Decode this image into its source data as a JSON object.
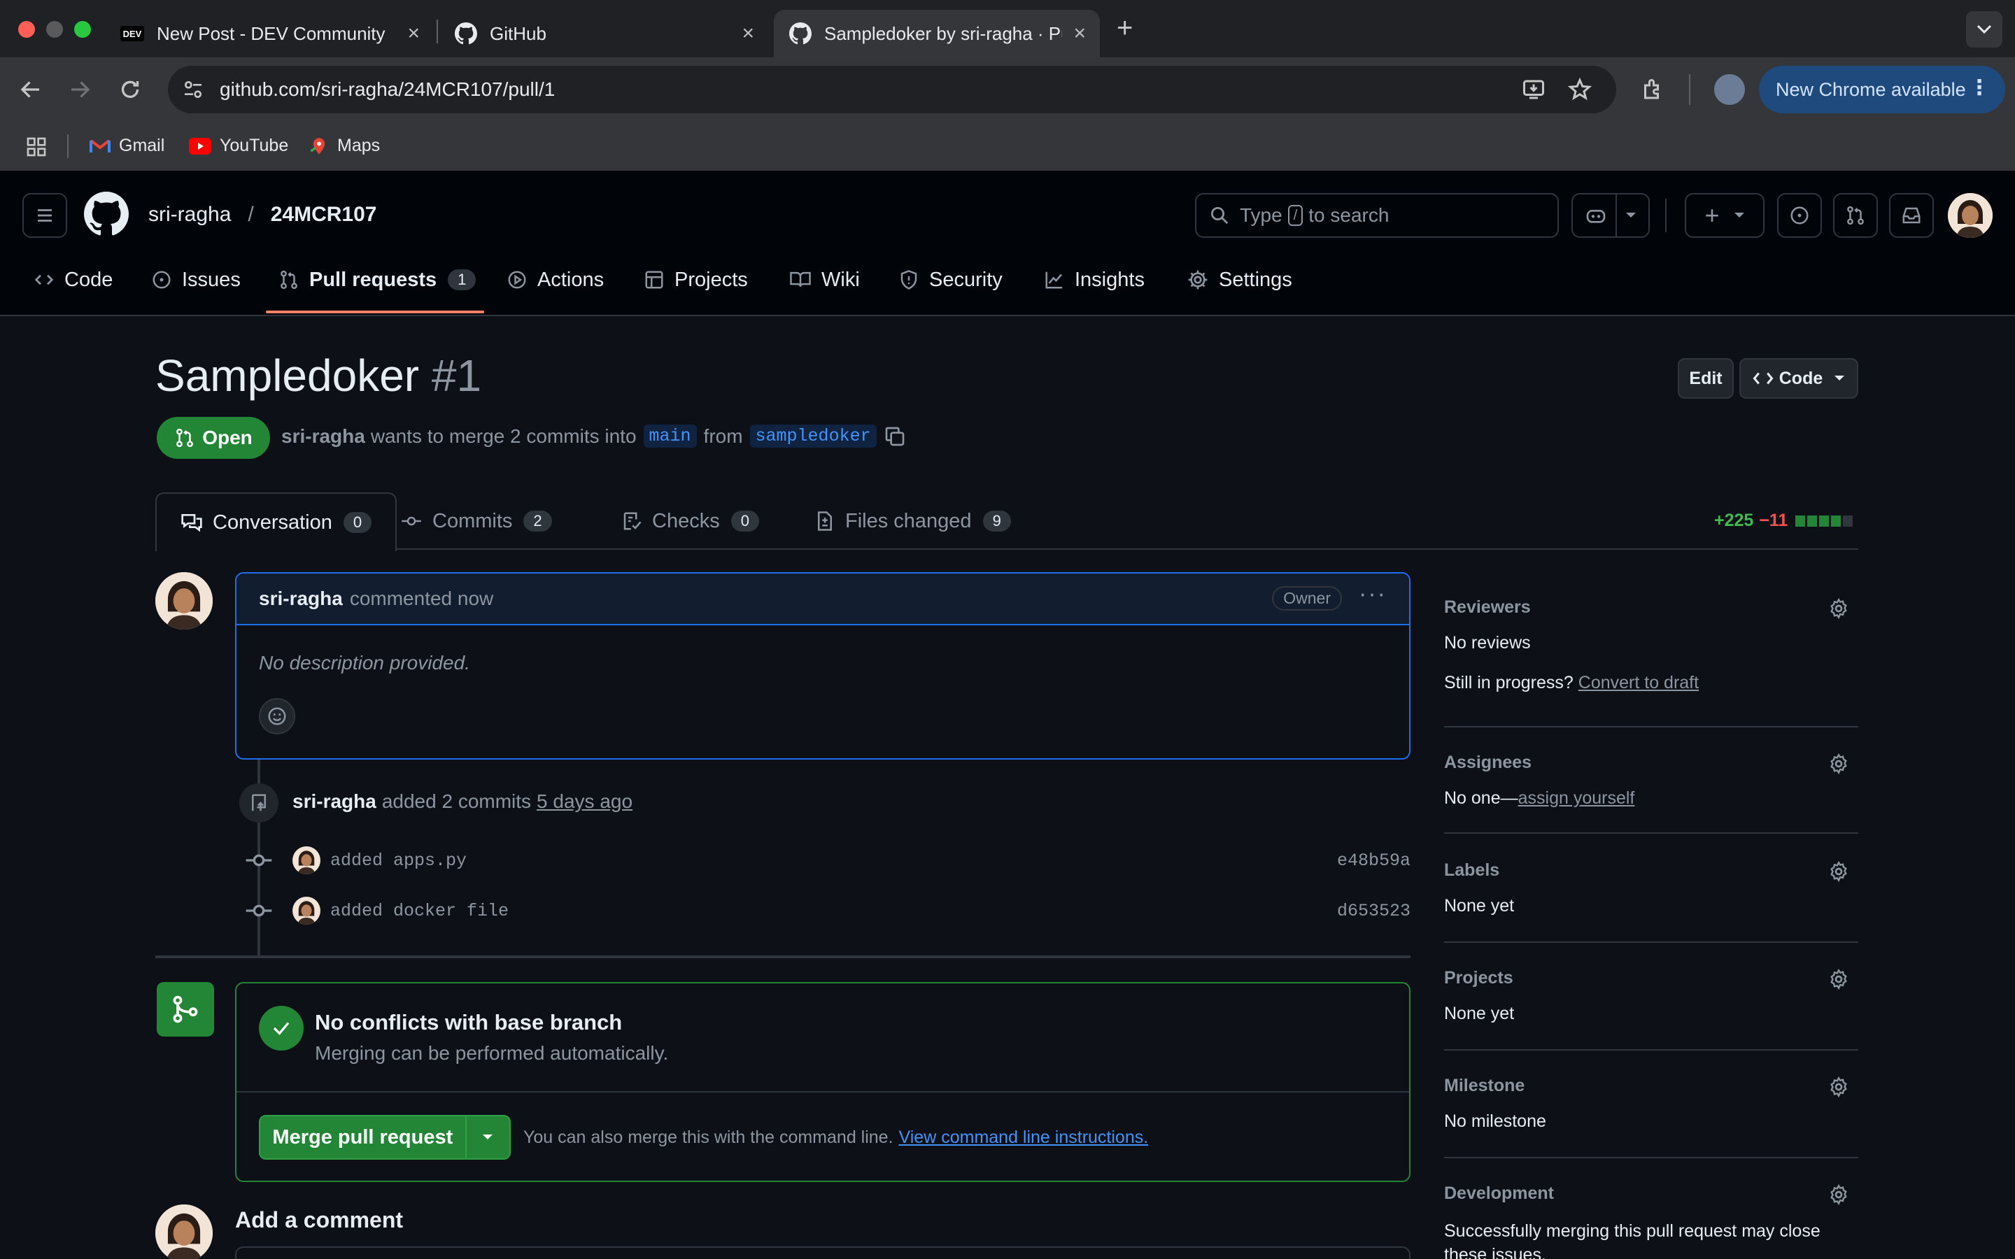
{
  "browser": {
    "tabs": [
      {
        "favicon": "dev-logo",
        "title": "New Post - DEV Community"
      },
      {
        "favicon": "github-logo",
        "title": "GitHub"
      },
      {
        "favicon": "github-logo",
        "title": "Sampledoker by sri-ragha · Pu",
        "active": true
      }
    ],
    "url": "github.com/sri-ragha/24MCR107/pull/1",
    "update_button": "New Chrome available",
    "bookmarks": [
      "Gmail",
      "YouTube",
      "Maps"
    ]
  },
  "header": {
    "owner": "sri-ragha",
    "separator": "/",
    "repo": "24MCR107",
    "search_prefix": "Type",
    "search_key": "/",
    "search_suffix": "to search"
  },
  "repo_nav": [
    {
      "icon": "code-icon",
      "label": "Code"
    },
    {
      "icon": "issues-icon",
      "label": "Issues"
    },
    {
      "icon": "pull-request-icon",
      "label": "Pull requests",
      "count": "1",
      "active": true
    },
    {
      "icon": "actions-icon",
      "label": "Actions"
    },
    {
      "icon": "projects-icon",
      "label": "Projects"
    },
    {
      "icon": "wiki-icon",
      "label": "Wiki"
    },
    {
      "icon": "security-icon",
      "label": "Security"
    },
    {
      "icon": "insights-icon",
      "label": "Insights"
    },
    {
      "icon": "settings-icon",
      "label": "Settings"
    }
  ],
  "pr": {
    "title": "Sampledoker",
    "number": "#1",
    "edit_label": "Edit",
    "code_label": "Code",
    "state": "Open",
    "author": "sri-ragha",
    "meta_middle": "wants to merge 2 commits into",
    "base_branch": "main",
    "meta_from": "from",
    "head_branch": "sampledoker"
  },
  "pr_tabs": [
    {
      "label": "Conversation",
      "count": "0"
    },
    {
      "label": "Commits",
      "count": "2"
    },
    {
      "label": "Checks",
      "count": "0"
    },
    {
      "label": "Files changed",
      "count": "9"
    }
  ],
  "diffstat": {
    "additions": "+225",
    "deletions": "−11",
    "green_blocks": 4,
    "total_blocks": 5
  },
  "comment": {
    "author": "sri-ragha",
    "action": "commented now",
    "role": "Owner",
    "body": "No description provided."
  },
  "commit_event": {
    "author": "sri-ragha",
    "action": "added 2 commits",
    "when": "5 days ago",
    "commits": [
      {
        "message": "added apps.py",
        "sha": "e48b59a"
      },
      {
        "message": "added docker file",
        "sha": "d653523"
      }
    ]
  },
  "merge": {
    "title": "No conflicts with base branch",
    "subtitle": "Merging can be performed automatically.",
    "button": "Merge pull request",
    "note": "You can also merge this with the command line.",
    "link": "View command line instructions."
  },
  "add_comment": "Add a comment",
  "sidebar": {
    "reviewers": {
      "heading": "Reviewers",
      "value": "No reviews",
      "draft_prompt": "Still in progress?",
      "draft_link": "Convert to draft"
    },
    "assignees": {
      "heading": "Assignees",
      "value": "No one—",
      "link": "assign yourself"
    },
    "labels": {
      "heading": "Labels",
      "value": "None yet"
    },
    "projects": {
      "heading": "Projects",
      "value": "None yet"
    },
    "milestone": {
      "heading": "Milestone",
      "value": "No milestone"
    },
    "development": {
      "heading": "Development",
      "value": "Successfully merging this pull request may close these issues."
    }
  },
  "colors": {
    "accent_green": "#238636",
    "link_blue": "#4493f8",
    "nav_underline": "#f78166",
    "bg": "#0d1117"
  }
}
